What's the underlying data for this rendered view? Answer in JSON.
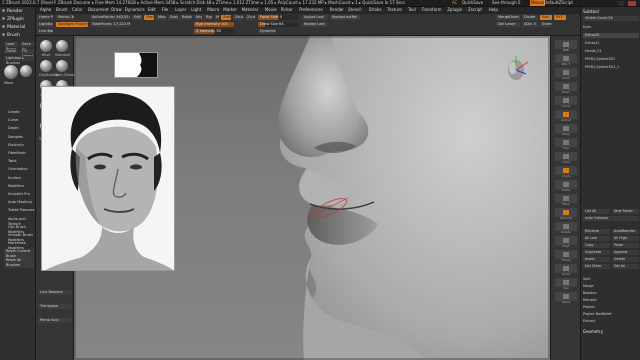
{
  "titlebar": {
    "app": "ZBrush 2022.0.7 [Pavel P Studio]",
    "doc": "ZBrush Document",
    "stats": "▸ Free Mem 14.276GB ▸ Active Mem 3458 ▸ Scratch Disk 48 ▸ ZTime ▸ 1.012 ZTimer ▸ 1.05 ▸ PolyCount ▸ 17.232 MP ▸ MeshCount ▸ 1   ▸ QuickSave In 17 Secs",
    "ac": "AC",
    "quicksave": "QuickSave",
    "seethrough": "See-through 0",
    "menus": "Menus",
    "script": "DefaultZScript"
  },
  "menubar": {
    "items": [
      "Alpha",
      "Brush",
      "Color",
      "Document",
      "Draw",
      "Dynamics",
      "Edit",
      "File",
      "Layer",
      "Light",
      "Macro",
      "Marker",
      "Material",
      "Movie",
      "Picker",
      "Preferences",
      "Render",
      "Stencil",
      "Stroke",
      "Texture",
      "Tool",
      "Transform",
      "Zplugin",
      "Zscript",
      "Help"
    ]
  },
  "left_panel": {
    "headers": [
      "Render",
      "ZPlugin",
      "Material",
      "Brush"
    ],
    "buttons": [
      "Load Brush",
      "Save As",
      "Clone",
      "Fill Object",
      "Lightbox ▸ Brushes"
    ],
    "brush_name": "Move"
  },
  "toptool": {
    "home": "Home Page",
    "lightbox": "LightBox",
    "live_boolean": "Live Boolean",
    "edit": "Edit",
    "draw": "Draw",
    "move": "Move",
    "scale": "Scale",
    "rotate": "Rotate",
    "focal_shift": "Focal Shift 0",
    "draw_size": "Draw Size 64",
    "rgb_intensity": "Rgb Intensity 100",
    "z_intensity": "Z Intensity 50",
    "dynamic": "Dynamic",
    "zadd": "Zadd",
    "zsub": "Zsub",
    "zcut": "Zcut",
    "mrgb": "Mrgb",
    "rgb": "Rgb",
    "m": "M",
    "points": "Points: 3000.12",
    "spotlight": "Spotlight Projection",
    "active_points": "ActivePoints: 942,814",
    "total_points": "TotalPoints: 17,222 Mil",
    "adjust_last": "Adjust Last",
    "replay_last": "Replay Last",
    "replay_relative": "ReplayLastRel",
    "merge_down": "MergeDown",
    "del_lower": "Del Lower",
    "div": "Divide",
    "edit_mode": "Edit",
    "store": "Store",
    "xyz": "XYZ",
    "subdiv": "SDiv 3"
  },
  "toolcol": {
    "labels": [
      "Move",
      "Standard",
      "ClayBuildup",
      "Dam_Standard",
      "hPolish",
      "Inflat",
      "Pinch",
      "TrimDynamic",
      "Move Topological",
      "Snakehook"
    ],
    "bottom": [
      "Live Boolean",
      "Transpose",
      "Persp Solo"
    ]
  },
  "left_lower": {
    "items": [
      "Create",
      "Curve",
      "Depth",
      "Samples",
      "Elasticity",
      "FiberMesh",
      "Twist",
      "Orientation",
      "Surface",
      "Modifiers",
      "Sculptris Pro",
      "Auto Masking",
      "Tablet Pressure",
      "Alpha and Texture",
      "Clip Brush Modifiers",
      "Smooth Brush Modifiers",
      "MarkMask Modifiers",
      "Reset Current Brush",
      "Reset All Brushes"
    ]
  },
  "rightcol": {
    "labels": [
      "BPR",
      "SPix 3",
      "Scroll",
      "Zoom",
      "Actual",
      "AAHalf",
      "Persp",
      "Floor",
      "Local",
      "L.Sym",
      "Frame",
      "Move",
      "Zoom3D",
      "Rotate",
      "PolyF",
      "Transp",
      "Ghost",
      "Solo",
      "Xpose"
    ]
  },
  "right_panel": {
    "title": "Subtool",
    "visible_count": "Visible Count 26",
    "subtools": [
      "Eyes",
      "Extract2",
      "Extract1",
      "Hands_01",
      "PM3D_Sphere3D1",
      "PM3D_Sphere3D1_1"
    ],
    "controls": [
      "List All",
      "Auto Collapse",
      "Rename",
      "AutoReorder",
      "All Low",
      "All High",
      "Copy",
      "Paste",
      "Duplicate",
      "Append",
      "Insert",
      "Delete",
      "Del Other",
      "Del All",
      "Split",
      "Merge",
      "Boolean",
      "Remesh",
      "Project",
      "Project BasRelief",
      "Extract",
      "Geometry"
    ],
    "new_folder": "New Folder"
  }
}
